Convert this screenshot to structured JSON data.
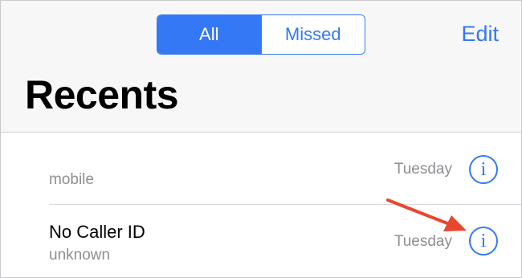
{
  "header": {
    "segments": {
      "all": "All",
      "missed": "Missed"
    },
    "edit_label": "Edit",
    "title": "Recents"
  },
  "calls": [
    {
      "name": "",
      "type": "mobile",
      "time": "Tuesday",
      "info_icon": "info-icon"
    },
    {
      "name": "No Caller ID",
      "type": "unknown",
      "time": "Tuesday",
      "info_icon": "info-icon"
    }
  ],
  "colors": {
    "accent": "#3478f6",
    "secondary_text": "#8e8e93",
    "annotation_arrow": "#e8472f"
  }
}
